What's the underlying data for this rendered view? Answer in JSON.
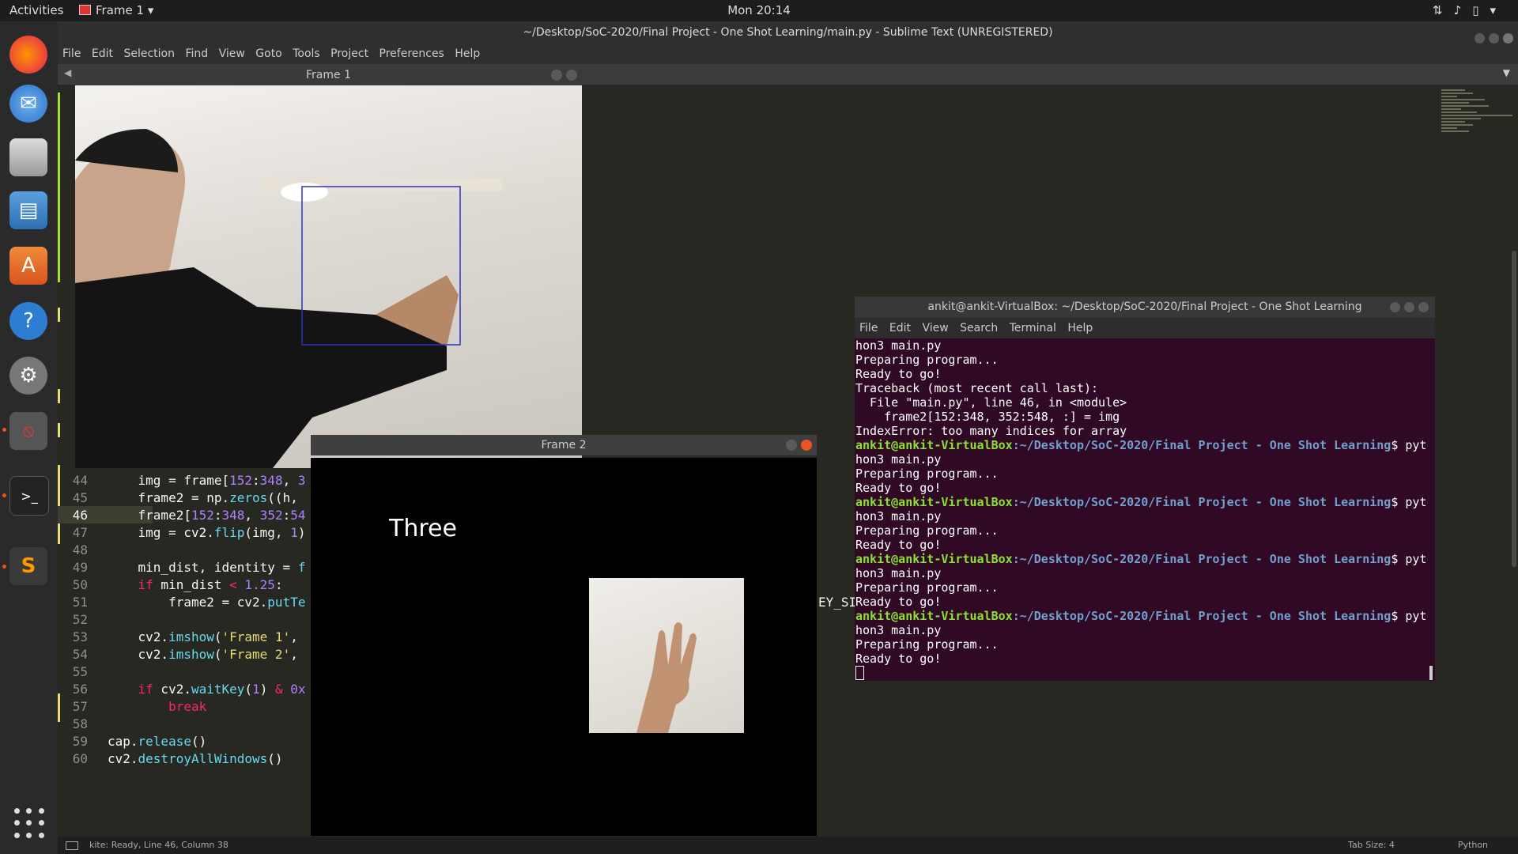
{
  "topbar": {
    "activities": "Activities",
    "app_menu": "Frame 1 ▾",
    "clock": "Mon 20:14"
  },
  "dock": {
    "items": [
      "firefox-icon",
      "thunderbird-icon",
      "files-icon",
      "libreoffice-writer-icon",
      "software-center-icon",
      "help-icon",
      "settings-icon",
      "opencv-window-icon",
      "terminal-icon",
      "sublime-text-icon"
    ],
    "apps_grid_icon": "show-applications-icon"
  },
  "sublime": {
    "title": "~/Desktop/SoC-2020/Final Project - One Shot Learning/main.py - Sublime Text (UNREGISTERED)",
    "menu": [
      "File",
      "Edit",
      "Selection",
      "Find",
      "View",
      "Goto",
      "Tools",
      "Project",
      "Preferences",
      "Help"
    ],
    "line_numbers": [
      "44",
      "45",
      "46",
      "47",
      "48",
      "49",
      "50",
      "51",
      "52",
      "53",
      "54",
      "55",
      "56",
      "57",
      "58",
      "59",
      "60"
    ],
    "current_line": "46",
    "code_peek_line51": "EY_SI",
    "status_left": "kite: Ready, Line 46, Column 38",
    "status_tab": "Tab Size: 4",
    "status_lang": "Python"
  },
  "frame1": {
    "title": "Frame 1"
  },
  "frame2": {
    "title": "Frame 2",
    "label": "Three"
  },
  "terminal": {
    "title": "ankit@ankit-VirtualBox: ~/Desktop/SoC-2020/Final Project - One Shot Learning",
    "menu": [
      "File",
      "Edit",
      "View",
      "Search",
      "Terminal",
      "Help"
    ],
    "prompt_user": "ankit@ankit-VirtualBox",
    "prompt_path": ":~/Desktop/SoC-2020/Final Project - One Shot Learning",
    "prompt_tail": "$ pyt",
    "lines": [
      "hon3 main.py",
      "Preparing program...",
      "Ready to go!",
      "Traceback (most recent call last):",
      "  File \"main.py\", line 46, in <module>",
      "    frame2[152:348, 352:548, :] = img",
      "IndexError: too many indices for array"
    ],
    "run_output": [
      "hon3 main.py",
      "Preparing program...",
      "Ready to go!"
    ]
  }
}
